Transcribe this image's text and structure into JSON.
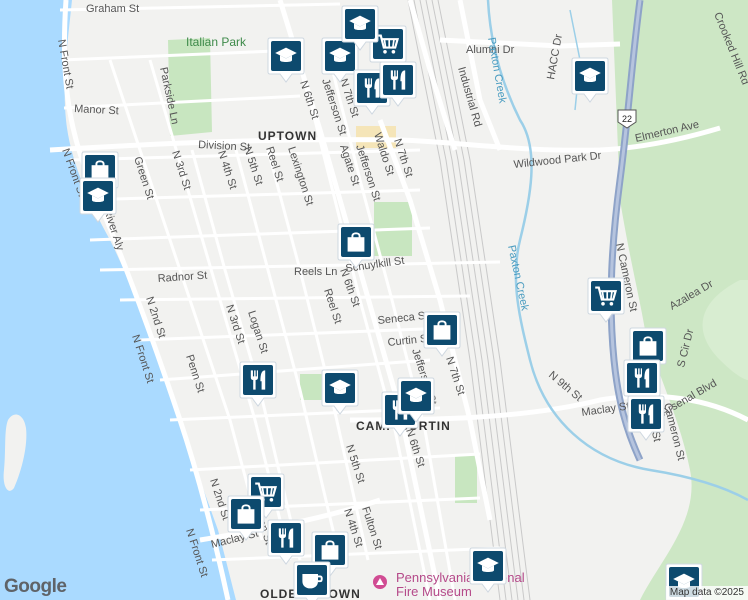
{
  "map": {
    "water_color": "#aadaff",
    "park_color": "#c8e6c0",
    "forest_color": "#cde7c5",
    "road_color": "#ffffff",
    "highway_color": "#8ea3c8",
    "pin_color": "#0d4a6e"
  },
  "labels": {
    "graham_st": "Graham St",
    "italian_park": "Italian Park",
    "n_6th_st_north": "N 6th St",
    "alumni_dr": "Alumni Dr",
    "paxton_creek_north": "Paxton Creek",
    "crooked_hill_rd": "Crooked Hill Rd",
    "n_front_st_north": "N Front St",
    "parkside_ln": "Parkside Ln",
    "manor_st": "Manor St",
    "jefferson_st_north": "Jefferson St",
    "n_7th_st_north": "N 7th St",
    "industrial_rd": "Industrial Rd",
    "hacc_dr": "HACC Dr",
    "route_22": "22",
    "division_st": "Division St",
    "uptown": "UPTOWN",
    "elmerton_ave": "Elmerton Ave",
    "wildwood_park_dr": "Wildwood Park Dr",
    "n_front_st_west": "N Front St",
    "green_st": "Green St",
    "n_3rd_st_north": "N 3rd St",
    "n_4th_st_north": "N 4th St",
    "n_5th_st_north": "N 5th St",
    "reel_st_north": "Reel St",
    "lexington_st": "Lexington St",
    "agate_st": "Agate St",
    "jefferson_st_mid": "Jefferson St",
    "waldo_st": "Waldo St",
    "n_7th_st_mid": "N 7th St",
    "river_aly": "River Aly",
    "reels_ln": "Reels Ln",
    "schuylkill_st": "Schuylkill St",
    "n_6th_st_mid": "N 6th St",
    "radnor_st": "Radnor St",
    "n_cameron_st": "N Cameron St",
    "paxton_creek_south": "Paxton Creek",
    "n_2nd_st": "N 2nd St",
    "n_3rd_st_mid": "N 3rd St",
    "logan_st": "Logan St",
    "reel_st_mid": "Reel St",
    "seneca_st": "Seneca St",
    "curtin_st": "Curtin St",
    "jefferson_st_south": "Jefferson St",
    "n_7th_st_south": "N 7th St",
    "azalea_dr": "Azalea Dr",
    "s_cir_dr": "S Cir Dr",
    "n_front_st_south": "N Front St",
    "penn_st_north": "Penn St",
    "camp_curtin": "CAMP CURTIN",
    "n_9th_st": "N 9th St",
    "maclay_st_east": "Maclay St",
    "arsenal_blvd": "Arsenal Blvd",
    "jilmo_st": "Jilmo St",
    "cameron_st": "Cameron St",
    "n_5th_st_south": "N 5th St",
    "n_6th_st_south": "N 6th St",
    "n_2nd_st_south": "N 2nd St",
    "maclay_st_west": "Maclay St",
    "penn_st_south": "Penn St",
    "fulton_st": "Fulton St",
    "n_4th_st_south": "N 4th St",
    "n_front_st_bottom": "N Front St",
    "olde_uptown": "OLDE UPTOWN",
    "museum_line1": "Pennsylvania National",
    "museum_line2": "Fire Museum"
  },
  "pins": [
    {
      "type": "school",
      "icon": "graduation-cap-icon"
    },
    {
      "type": "school",
      "icon": "graduation-cap-icon"
    },
    {
      "type": "grocery",
      "icon": "shopping-cart-icon"
    },
    {
      "type": "restaurant",
      "icon": "fork-knife-icon"
    },
    {
      "type": "restaurant",
      "icon": "fork-knife-icon"
    },
    {
      "type": "school",
      "icon": "graduation-cap-icon"
    },
    {
      "type": "shopping",
      "icon": "shopping-bag-icon"
    },
    {
      "type": "school",
      "icon": "graduation-cap-icon"
    },
    {
      "type": "shopping",
      "icon": "shopping-bag-icon"
    },
    {
      "type": "shopping",
      "icon": "shopping-bag-icon"
    },
    {
      "type": "grocery",
      "icon": "shopping-cart-icon"
    },
    {
      "type": "shopping",
      "icon": "shopping-bag-icon"
    },
    {
      "type": "restaurant",
      "icon": "fork-knife-icon"
    },
    {
      "type": "restaurant",
      "icon": "fork-knife-icon"
    },
    {
      "type": "school",
      "icon": "graduation-cap-icon"
    },
    {
      "type": "school",
      "icon": "graduation-cap-icon"
    },
    {
      "type": "restaurant",
      "icon": "fork-knife-icon"
    },
    {
      "type": "restaurant",
      "icon": "fork-knife-icon"
    },
    {
      "type": "school",
      "icon": "graduation-cap-icon"
    },
    {
      "type": "grocery",
      "icon": "shopping-cart-icon"
    },
    {
      "type": "shopping",
      "icon": "shopping-bag-icon"
    },
    {
      "type": "restaurant",
      "icon": "fork-knife-icon"
    },
    {
      "type": "shopping",
      "icon": "shopping-bag-icon"
    },
    {
      "type": "cafe",
      "icon": "coffee-cup-icon"
    },
    {
      "type": "school",
      "icon": "graduation-cap-icon"
    },
    {
      "type": "school",
      "icon": "graduation-cap-icon"
    }
  ],
  "footer": {
    "google_logo": "Google",
    "attribution": "Map data ©2025"
  }
}
